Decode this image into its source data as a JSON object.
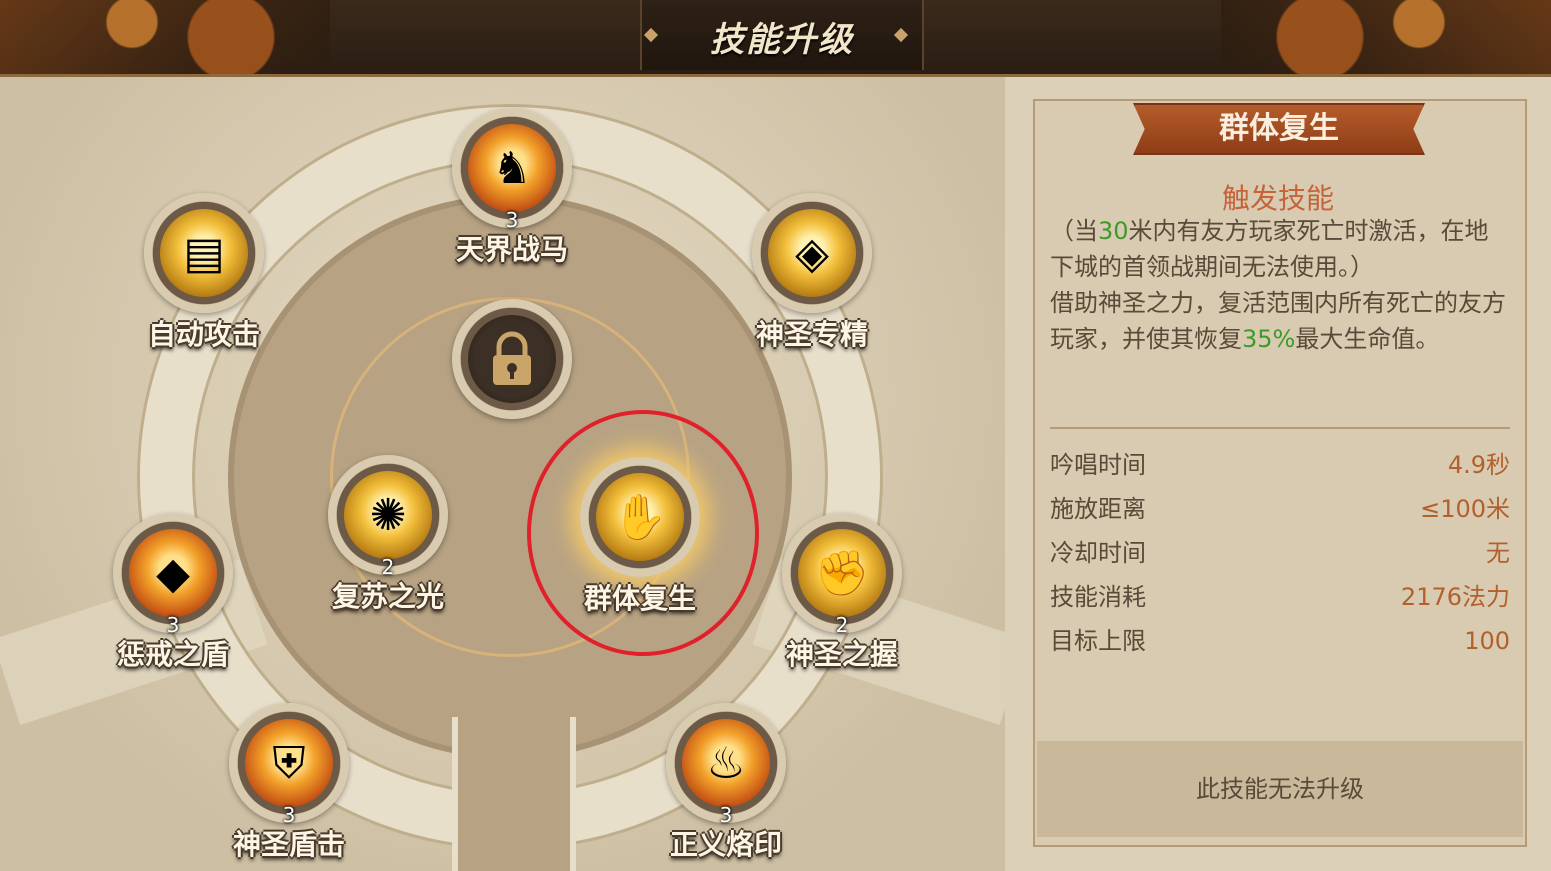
{
  "header": {
    "title": "技能升级"
  },
  "skills": [
    {
      "id": "tianjie",
      "name": "天界战马",
      "level": "3",
      "icon": "horse-icon"
    },
    {
      "id": "zidong",
      "name": "自动攻击",
      "level": "",
      "icon": "blocks-icon"
    },
    {
      "id": "shensheng_zhuanjing",
      "name": "神圣专精",
      "level": "",
      "icon": "shield-burst-icon"
    },
    {
      "id": "locked",
      "name": "",
      "level": "",
      "icon": "lock-icon"
    },
    {
      "id": "fusu",
      "name": "复苏之光",
      "level": "2",
      "icon": "light-burst-icon"
    },
    {
      "id": "qunti",
      "name": "群体复生",
      "level": "",
      "icon": "holy-hand-icon"
    },
    {
      "id": "chengjie",
      "name": "惩戒之盾",
      "level": "3",
      "icon": "gem-shield-icon"
    },
    {
      "id": "shensheng_zhiwo",
      "name": "神圣之握",
      "level": "2",
      "icon": "fist-icon"
    },
    {
      "id": "dunji",
      "name": "神圣盾击",
      "level": "3",
      "icon": "gauntlet-icon"
    },
    {
      "id": "zhengyi",
      "name": "正义烙印",
      "level": "3",
      "icon": "flame-icon"
    }
  ],
  "detail": {
    "title": "群体复生",
    "type": "触发技能",
    "desc1_pre": "（当",
    "desc1_num": "30",
    "desc1_post": "米内有友方玩家死亡时激活，在地下城的首领战期间无法使用。）",
    "desc2_pre": "借助神圣之力，复活范围内所有死亡的友方玩家，并使其恢复",
    "desc2_num": "35%",
    "desc2_post": "最大生命值。",
    "stats": [
      {
        "label": "吟唱时间",
        "value": "4.9秒"
      },
      {
        "label": "施放距离",
        "value": "≤100米"
      },
      {
        "label": "冷却时间",
        "value": "无"
      },
      {
        "label": "技能消耗",
        "value": "2176法力"
      },
      {
        "label": "目标上限",
        "value": "100"
      }
    ],
    "footer": "此技能无法升级"
  }
}
